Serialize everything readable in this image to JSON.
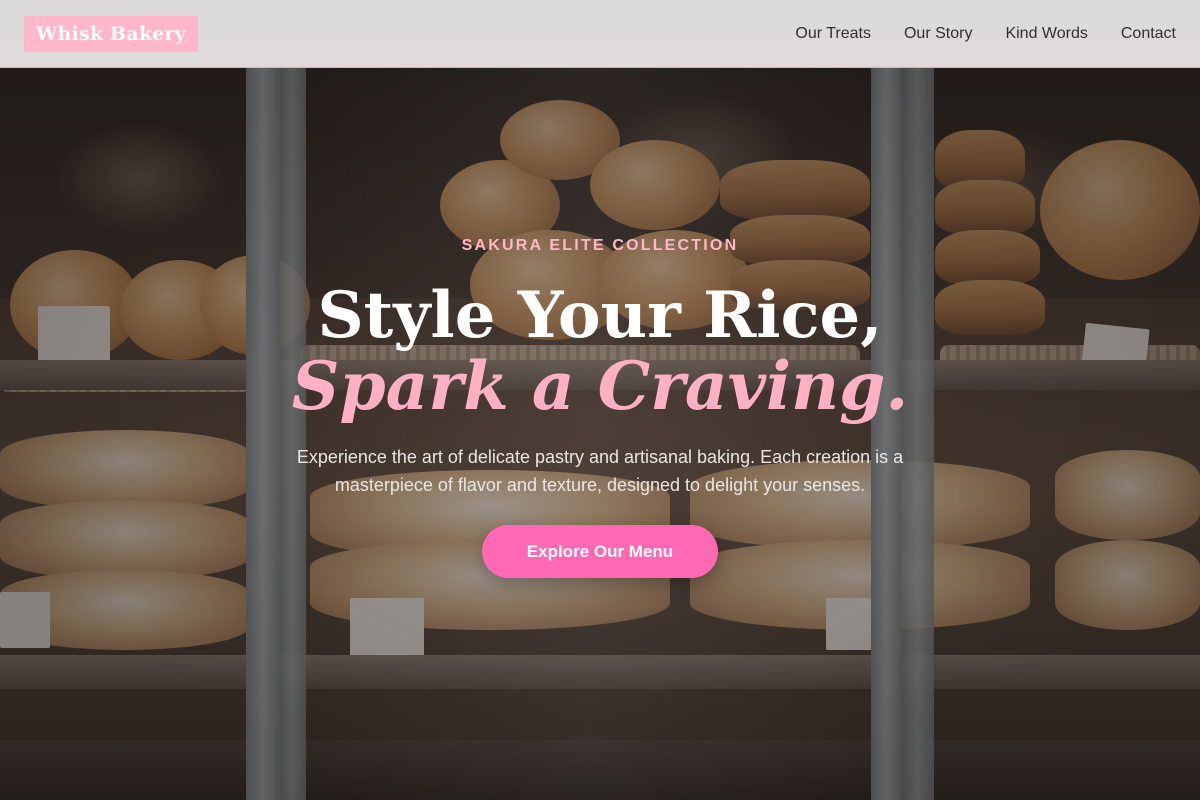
{
  "brand": {
    "logo_text": "Whisk Bakery",
    "accent": "#ffb7c9",
    "cta_color": "#ff69b4"
  },
  "nav": {
    "items": [
      {
        "label": "Our Treats"
      },
      {
        "label": "Our Story"
      },
      {
        "label": "Kind Words"
      },
      {
        "label": "Contact"
      }
    ]
  },
  "hero": {
    "eyebrow": "SAKURA ELITE COLLECTION",
    "title_line1": "Style Your Rice,",
    "title_line2": "Spark a Craving.",
    "subtitle": "Experience the art of delicate pastry and artisanal baking. Each creation is a masterpiece of flavor and texture, designed to delight your senses.",
    "cta_label": "Explore Our Menu"
  },
  "background": {
    "description_icon": "bakery-display-image"
  }
}
